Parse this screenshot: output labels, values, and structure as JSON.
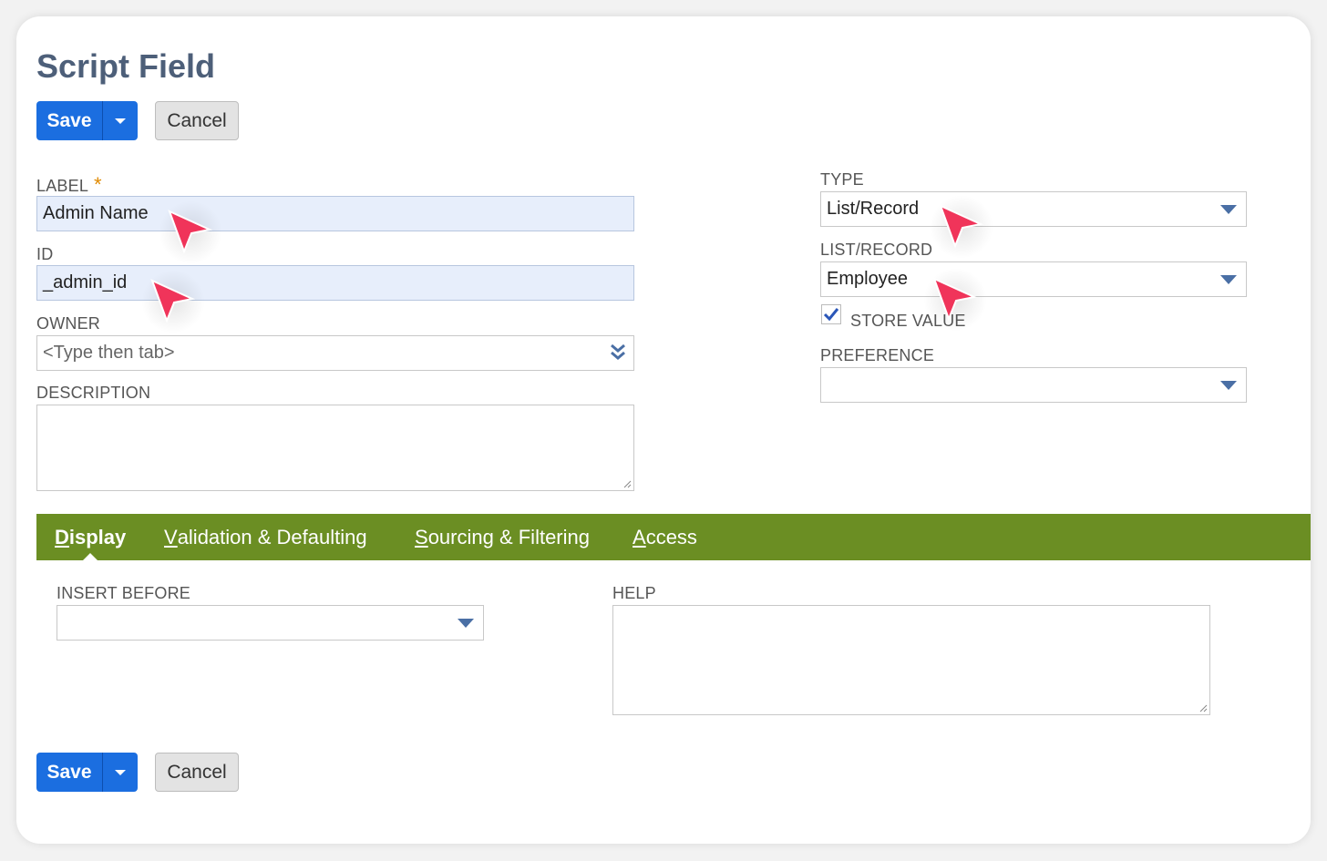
{
  "page_title": "Script Field",
  "buttons": {
    "save_label": "Save",
    "cancel_label": "Cancel"
  },
  "fields": {
    "label": {
      "label": "LABEL",
      "required_mark": "*",
      "value": "Admin Name"
    },
    "id": {
      "label": "ID",
      "value": "_admin_id"
    },
    "owner": {
      "label": "OWNER",
      "placeholder": "<Type then tab>"
    },
    "description": {
      "label": "DESCRIPTION",
      "value": ""
    },
    "type": {
      "label": "TYPE",
      "value": "List/Record"
    },
    "list_record": {
      "label": "LIST/RECORD",
      "value": "Employee"
    },
    "store_value": {
      "label": "STORE VALUE",
      "checked": true
    },
    "preference": {
      "label": "PREFERENCE",
      "value": ""
    }
  },
  "tabs": [
    {
      "first": "D",
      "rest": "isplay",
      "active": true
    },
    {
      "first": "V",
      "rest": "alidation & Defaulting",
      "active": false
    },
    {
      "first": "S",
      "rest": "ourcing & Filtering",
      "active": false
    },
    {
      "first": "A",
      "rest": "ccess",
      "active": false
    }
  ],
  "display_tab": {
    "insert_before": {
      "label": "INSERT BEFORE",
      "value": ""
    },
    "help": {
      "label": "HELP",
      "value": ""
    }
  },
  "colors": {
    "primary_button": "#1b6ee0",
    "tab_bar": "#6b8e23",
    "title": "#4d5f79",
    "cursor": "#f0345a",
    "required": "#e08a00",
    "dropdown_arrow": "#4a6fa5"
  },
  "icons": {
    "save_menu": "caret-down-icon",
    "dropdown": "triangle-down-icon",
    "owner_popup": "double-chevron-down-icon",
    "checkbox": "checkmark-icon",
    "annotation": "pointer-cursor-icon"
  }
}
